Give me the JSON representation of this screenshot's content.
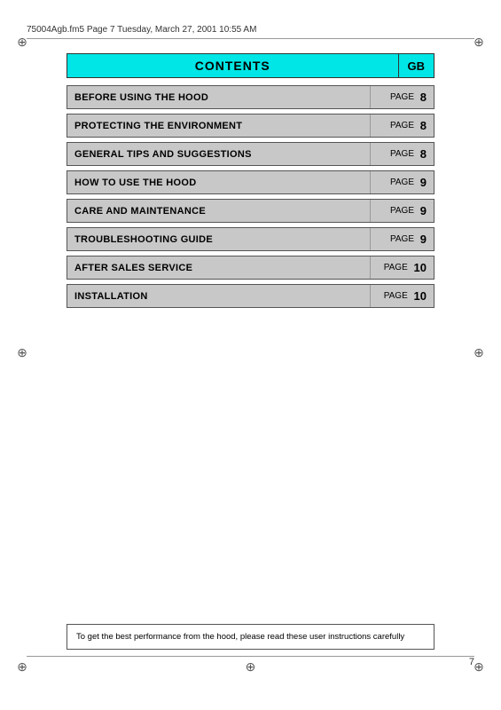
{
  "header": {
    "file_info": "75004Agb.fm5  Page 7  Tuesday, March 27, 2001  10:55 AM"
  },
  "contents_title": "CONTENTS",
  "contents_gb": "GB",
  "toc_rows": [
    {
      "id": "before-using",
      "label": "BEFORE USING THE HOOD",
      "page_label": "PAGE",
      "page_num": "8",
      "cyan": false
    },
    {
      "id": "protecting-env",
      "label": "PROTECTING THE ENVIRONMENT",
      "page_label": "PAGE",
      "page_num": "8",
      "cyan": false
    },
    {
      "id": "general-tips",
      "label": "GENERAL TIPS AND SUGGESTIONS",
      "page_label": "PAGE",
      "page_num": "8",
      "cyan": false
    },
    {
      "id": "how-to-use",
      "label": "HOW TO USE THE HOOD",
      "page_label": "PAGE",
      "page_num": "9",
      "cyan": false
    },
    {
      "id": "care-maintenance",
      "label": "CARE AND MAINTENANCE",
      "page_label": "PAGE",
      "page_num": "9",
      "cyan": false
    },
    {
      "id": "troubleshooting",
      "label": "TROUBLESHOOTING GUIDE",
      "page_label": "PAGE",
      "page_num": "9",
      "cyan": false
    },
    {
      "id": "after-sales",
      "label": "AFTER SALES SERVICE",
      "page_label": "PAGE",
      "page_num": "10",
      "cyan": false
    },
    {
      "id": "installation",
      "label": "INSTALLATION",
      "page_label": "PAGE",
      "page_num": "10",
      "cyan": false
    }
  ],
  "footer_note": "To get the best performance from the hood, please read these user instructions carefully",
  "page_number": "7"
}
